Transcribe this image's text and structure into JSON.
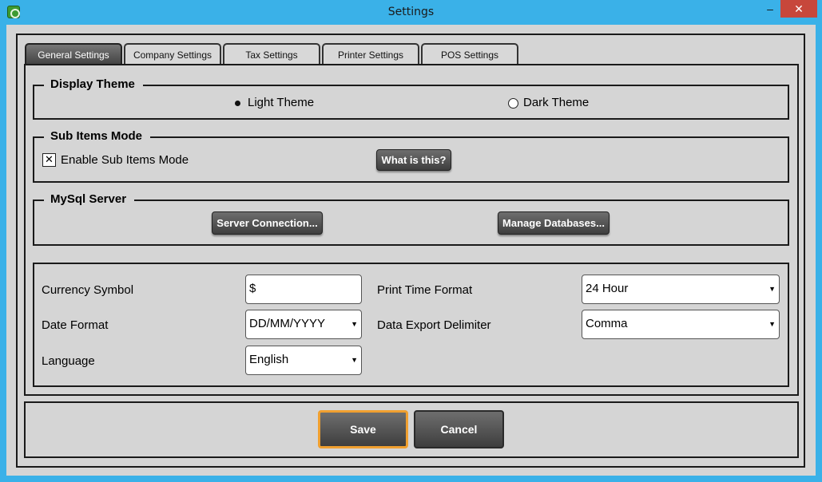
{
  "window": {
    "title": "Settings",
    "minimize": "–",
    "close": "✕"
  },
  "tabs": [
    {
      "label": "General Settings",
      "active": true
    },
    {
      "label": "Company Settings"
    },
    {
      "label": "Tax Settings"
    },
    {
      "label": "Printer Settings"
    },
    {
      "label": "POS Settings"
    }
  ],
  "display_theme": {
    "title": "Display Theme",
    "options": [
      {
        "label": "Light Theme",
        "selected": true
      },
      {
        "label": "Dark Theme",
        "selected": false
      }
    ]
  },
  "sub_items": {
    "title": "Sub Items Mode",
    "checkbox_label": "Enable Sub Items Mode",
    "checked": true,
    "check_mark": "✕",
    "help_button": "What is this?"
  },
  "mysql": {
    "title": "MySql Server",
    "connection_button": "Server Connection...",
    "manage_button": "Manage Databases..."
  },
  "fields": {
    "currency_symbol": {
      "label": "Currency Symbol",
      "value": "$"
    },
    "date_format": {
      "label": "Date Format",
      "value": "DD/MM/YYYY"
    },
    "language": {
      "label": "Language",
      "value": "English"
    },
    "print_time_format": {
      "label": "Print Time Format",
      "value": "24 Hour"
    },
    "data_export_delimiter": {
      "label": "Data Export Delimiter",
      "value": "Comma"
    },
    "dropdown_arrow": "▼"
  },
  "footer": {
    "save": "Save",
    "cancel": "Cancel"
  },
  "colors": {
    "accent_focus": "#f0a030",
    "titlebar": "#3ab1e8",
    "close": "#c7473b"
  }
}
